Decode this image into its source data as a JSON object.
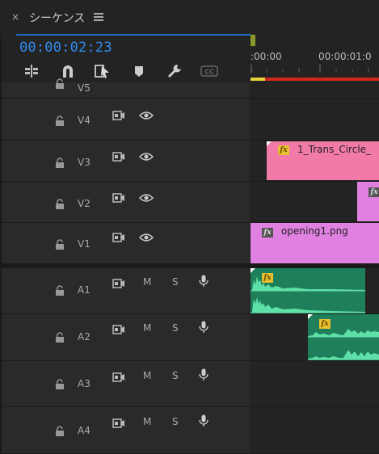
{
  "panel": {
    "close_label": "×",
    "title": "シーケンス",
    "timecode": "00:00:02:23"
  },
  "tools": [
    {
      "icon": "snap-insert-icon"
    },
    {
      "icon": "magnet-snap-icon"
    },
    {
      "icon": "linked-selection-icon"
    },
    {
      "icon": "add-marker-icon"
    },
    {
      "icon": "wrench-settings-icon"
    },
    {
      "icon": "captions-icon",
      "label": "CC"
    }
  ],
  "ruler": {
    "labels": [
      ":00:00",
      "00:00:01:0"
    ]
  },
  "video_tracks": [
    {
      "name": "V5"
    },
    {
      "name": "V4"
    },
    {
      "name": "V3"
    },
    {
      "name": "V2"
    },
    {
      "name": "V1"
    }
  ],
  "audio_tracks": [
    {
      "name": "A1",
      "mute": "M",
      "solo": "S"
    },
    {
      "name": "A2",
      "mute": "M",
      "solo": "S"
    },
    {
      "name": "A3",
      "mute": "M",
      "solo": "S"
    },
    {
      "name": "A4",
      "mute": "M",
      "solo": "S"
    }
  ],
  "clips": {
    "v3_label": "1_Trans_Circle_",
    "v1_label": "opening1.png",
    "fx_label": "fx"
  },
  "colors": {
    "accent": "#2d8ceb",
    "pink_clip": "#f27aa8",
    "violet_clip": "#e080e0",
    "audio_clip": "#1f7f5a",
    "work_area_red": "#d0281c",
    "work_area_yellow": "#e8d23a"
  }
}
